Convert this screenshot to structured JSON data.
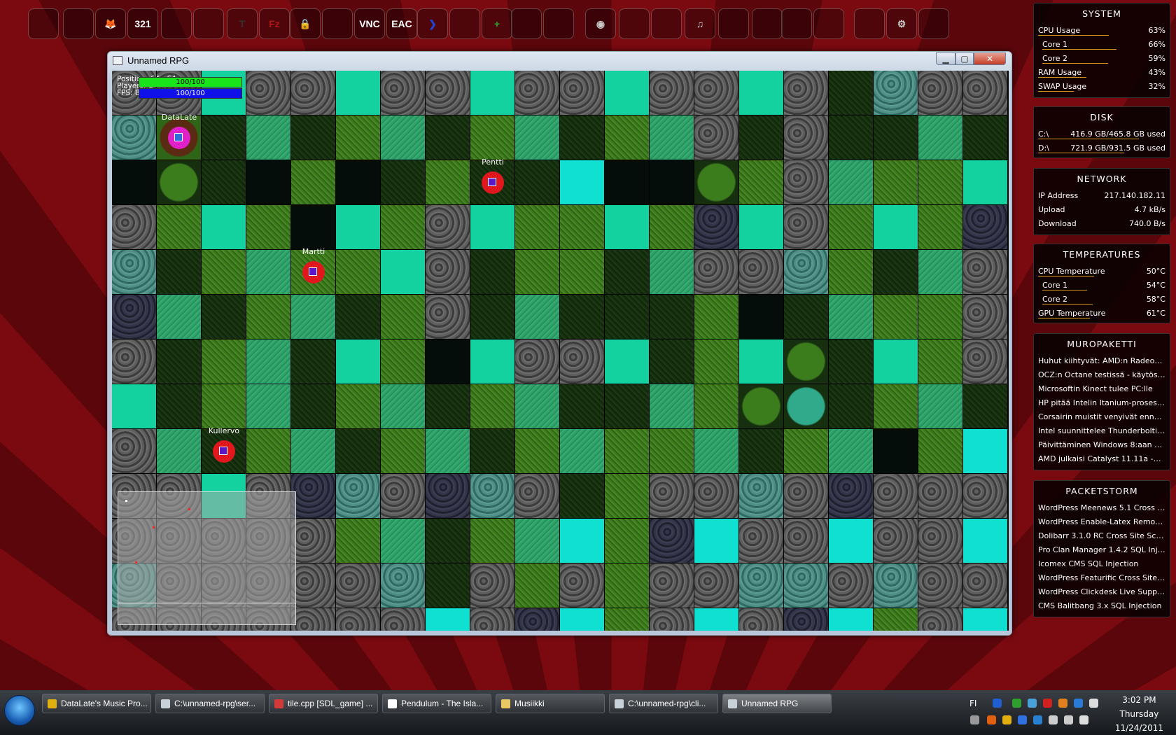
{
  "dock": {
    "icons": [
      {
        "name": "chrome-icon",
        "glyph": "",
        "color": "#e0b010"
      },
      {
        "name": "office-icon",
        "glyph": "",
        "color": "#e8642a"
      },
      {
        "name": "foobar-icon",
        "glyph": "🦊",
        "color": "#ffffff"
      },
      {
        "name": "calendar-321-icon",
        "glyph": "321",
        "color": "#ffffff"
      },
      {
        "name": "vmware-icon",
        "glyph": "",
        "color": "#9aa9bb"
      },
      {
        "name": "steam-icon",
        "glyph": "",
        "color": "#2a3f6a"
      },
      {
        "name": "typora-icon",
        "glyph": "T",
        "color": "#333333"
      },
      {
        "name": "filezilla-icon",
        "glyph": "Fz",
        "color": "#b8141a"
      },
      {
        "name": "lock-download-icon",
        "glyph": "🔒",
        "color": "#5a6a80"
      },
      {
        "name": "putty-icon",
        "glyph": "",
        "color": "#3a3a3a"
      },
      {
        "name": "vnc-icon",
        "glyph": "VNC",
        "color": "#ffffff"
      },
      {
        "name": "eac-icon",
        "glyph": "EAC",
        "color": "#ffffff"
      },
      {
        "name": "arrow-app-icon",
        "glyph": "❯",
        "color": "#2244cc"
      },
      {
        "name": "lion-icon",
        "glyph": "",
        "color": "#c06010"
      },
      {
        "name": "git-icon",
        "glyph": "+",
        "color": "#22aa22"
      },
      {
        "name": "window-preview-icon",
        "glyph": "",
        "color": "#d0d8e0"
      },
      {
        "name": "window-preview-icon-2",
        "glyph": "",
        "color": "#d0d8e0"
      },
      {
        "name": "disc-icon",
        "glyph": "◉",
        "color": "#cccccc"
      },
      {
        "name": "mouse-icon",
        "glyph": "",
        "color": "#cccccc"
      },
      {
        "name": "folder-bomb-icon",
        "glyph": "",
        "color": "#cccccc"
      },
      {
        "name": "folder-music-icon",
        "glyph": "♫",
        "color": "#cccccc"
      },
      {
        "name": "folder-calendar-icon",
        "glyph": "",
        "color": "#cccccc"
      },
      {
        "name": "folder-device-icon",
        "glyph": "",
        "color": "#cccccc"
      },
      {
        "name": "floppy-icon",
        "glyph": "",
        "color": "#cccccc"
      },
      {
        "name": "monitor-icon",
        "glyph": "",
        "color": "#cccccc"
      },
      {
        "name": "network-icon",
        "glyph": "",
        "color": "#cccccc"
      },
      {
        "name": "settings-gear-icon",
        "glyph": "⚙",
        "color": "#cccccc"
      },
      {
        "name": "trash-icon",
        "glyph": "",
        "color": "#cccccc"
      }
    ]
  },
  "window": {
    "title": "Unnamed RPG",
    "min_glyph": "▁",
    "max_glyph": "▢",
    "close_glyph": "✕"
  },
  "game": {
    "hud": {
      "position": "Position: 64 , 64",
      "players": "Players: 1",
      "fps": "FPS: 81",
      "hp": "100/100",
      "mp": "100/100",
      "hp_value": 100,
      "mp_value": 100
    },
    "tile_map": [
      "stone,stone,teal,stone,stone,teal,stone,stone,teal,stone,stone,teal,stone,stone,teal,stone,dark,stoneteal,stone,stone",
      "stoneteal,bushred,dark,green2,dark,green,green2,dark,green,green2,dark,green,green2,stone,dark,stone,dark,dark,green2,dark",
      "black,bush,dark,black,green,black,dark,green,dark,dark,cyan,black,black,bush,green,stone,green2,green,green,teal",
      "stone,green,teal,green,black,teal,green,stone,teal,green,green,teal,green,stonedark,teal,stone,green,teal,green,stonedark",
      "stoneteal,dark,green,green2,green,green,teal,stone,dark,green,green,dark,green2,stone,stone,stoneteal,green,dark,green2,stone",
      "stonedark,green2,dark,green,green2,dark,green,stone,dark,green2,dark,dark,dark,green,black,dark,green2,green,green,stone",
      "stone,dark,green,green2,dark,teal,green,black,teal,stone,stone,teal,dark,green,teal,bush,dark,teal,green,stone",
      "teal,dark,green,green2,dark,green,green2,dark,green,green2,dark,dark,green2,green,bush,bushteal,dark,green,green2,dark",
      "stone,green2,dark,green,green2,dark,green,green2,dark,green,green2,green,green,green2,dark,green,green2,black,green,cyan",
      "stone,stone,teal,stone,stonedark,stoneteal,stone,stonedark,stoneteal,stone,dark,green,stone,stone,stoneteal,stone,stonedark,stone,stone,stone",
      "stone,stone,stone,stone,stone,green,green2,dark,green,green2,cyan,green,stonedark,cyan,stone,stone,cyan,stone,stone,cyan",
      "stoneteal,stone,stone,stone,stone,stone,stoneteal,dark,stone,green,stone,green,stone,stone,stoneteal,stoneteal,stone,stoneteal,stone,stone",
      "stone,stone,stone,stone,stone,stone,stone,cyan,stone,stonedark,cyan,green,stone,cyan,stone,stonedark,cyan,green,stone,cyan"
    ],
    "players": [
      {
        "name": "DataLate",
        "col": 1,
        "row": 1,
        "self": true
      },
      {
        "name": "Pentti",
        "col": 8,
        "row": 2,
        "self": false
      },
      {
        "name": "Martti",
        "col": 4,
        "row": 4,
        "self": false
      },
      {
        "name": "Kullervo",
        "col": 2,
        "row": 8,
        "self": false
      }
    ]
  },
  "gadgets": {
    "system": {
      "title": "SYSTEM",
      "rows": [
        {
          "label": "CPU Usage",
          "value": "63%",
          "pct": 63,
          "sub": false
        },
        {
          "label": "Core 1",
          "value": "66%",
          "pct": 66,
          "sub": true
        },
        {
          "label": "Core 2",
          "value": "59%",
          "pct": 59,
          "sub": true
        },
        {
          "label": "RAM Usage",
          "value": "43%",
          "pct": 43,
          "sub": false
        },
        {
          "label": "SWAP Usage",
          "value": "32%",
          "pct": 32,
          "sub": false
        }
      ]
    },
    "disk": {
      "title": "DISK",
      "rows": [
        {
          "label": "C:\\",
          "value": "416.9 GB/465.8 GB used",
          "pct": 90
        },
        {
          "label": "D:\\",
          "value": "721.9 GB/931.5 GB used",
          "pct": 77
        }
      ]
    },
    "network": {
      "title": "NETWORK",
      "rows": [
        {
          "label": "IP Address",
          "value": "217.140.182.11"
        },
        {
          "label": "Upload",
          "value": "4.7 kB/s"
        },
        {
          "label": "Download",
          "value": "740.0 B/s"
        }
      ]
    },
    "temperatures": {
      "title": "TEMPERATURES",
      "rows": [
        {
          "label": "CPU Temperature",
          "value": "50°C",
          "pct": 50,
          "sub": false
        },
        {
          "label": "Core 1",
          "value": "54°C",
          "pct": 40,
          "sub": true
        },
        {
          "label": "Core 2",
          "value": "58°C",
          "pct": 45,
          "sub": true
        },
        {
          "label": "GPU Temperature",
          "value": "61°C",
          "pct": 46,
          "sub": false
        }
      ]
    },
    "muropaketti": {
      "title": "MUROPAKETTI",
      "items": [
        "Huhut kiihtyvät: AMD:n Radeon H...",
        "OCZ:n Octane testissä - käytössä I...",
        "Microsoftin Kinect tulee PC:lle",
        "HP pitää Intelin Itanium-prosessori...",
        "Corsairin muistit venyivät ennätys...",
        "Intel suunnittelee Thunderboltia k...",
        "Päivittäminen Windows 8:aan vaat...",
        "AMD julkaisi Catalyst 11.11a -ajurit"
      ]
    },
    "packetstorm": {
      "title": "PACKETSTORM",
      "items": [
        "WordPress Meenews 5.1 Cross Site...",
        "WordPress Enable-Latex Remote F...",
        "Dolibarr 3.1.0 RC Cross Site Script...",
        "Pro Clan Manager 1.4.2 SQL Inject...",
        "Icomex CMS SQL Injection",
        "WordPress Featurific Cross Site Sc...",
        "WordPress Clickdesk Live Support...",
        "CMS Balitbang 3.x SQL Injection"
      ]
    }
  },
  "taskbar": {
    "buttons": [
      {
        "label": "DataLate's Music Pro...",
        "color": "#e0b010",
        "active": false
      },
      {
        "label": "C:\\unnamed-rpg\\ser...",
        "color": "#c8d0d8",
        "active": false
      },
      {
        "label": "tile.cpp [SDL_game] ...",
        "color": "#d23a3a",
        "active": false
      },
      {
        "label": "Pendulum - The Isla...",
        "color": "#ffffff",
        "active": false
      },
      {
        "label": "Musiikki",
        "color": "#e8c860",
        "active": false
      },
      {
        "label": "C:\\unnamed-rpg\\cli...",
        "color": "#c8d0d8",
        "active": false
      },
      {
        "label": "Unnamed RPG",
        "color": "#c8d0d8",
        "active": true
      }
    ],
    "language": "FI",
    "clock": {
      "time": "3:02 PM",
      "day": "Thursday",
      "date": "11/24/2011"
    }
  }
}
